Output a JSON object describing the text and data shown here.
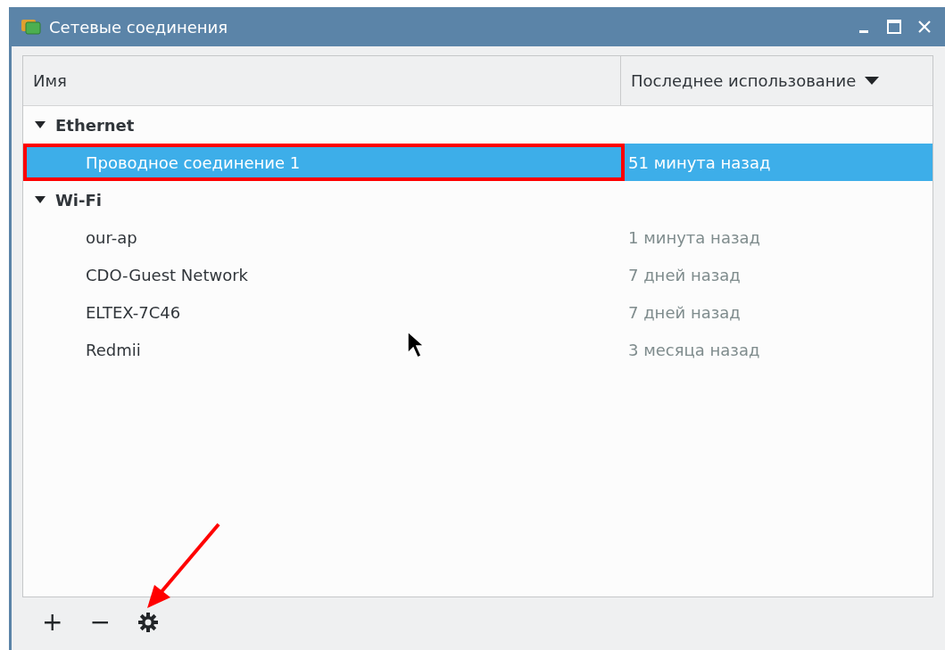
{
  "window": {
    "title": "Сетевые соединения"
  },
  "table": {
    "columns": [
      {
        "label": "Имя",
        "sorted": false
      },
      {
        "label": "Последнее использование",
        "sorted": true
      }
    ],
    "groups": [
      {
        "name": "Ethernet",
        "expanded": true,
        "children": [
          {
            "name": "Проводное соединение 1",
            "last_used": "51 минута назад",
            "selected": true,
            "highlighted": true
          }
        ]
      },
      {
        "name": "Wi-Fi",
        "expanded": true,
        "children": [
          {
            "name": "our-ap",
            "last_used": "1 минута назад",
            "selected": false,
            "highlighted": false
          },
          {
            "name": "CDO-Guest Network",
            "last_used": "7 дней назад",
            "selected": false,
            "highlighted": false
          },
          {
            "name": "ELTEX-7C46",
            "last_used": "7 дней назад",
            "selected": false,
            "highlighted": false
          },
          {
            "name": "Redmii",
            "last_used": "3 месяца назад",
            "selected": false,
            "highlighted": false
          }
        ]
      }
    ]
  },
  "toolbar": [
    {
      "kind": "text",
      "label": "+"
    },
    {
      "kind": "text",
      "label": "−"
    },
    {
      "kind": "gear"
    }
  ]
}
